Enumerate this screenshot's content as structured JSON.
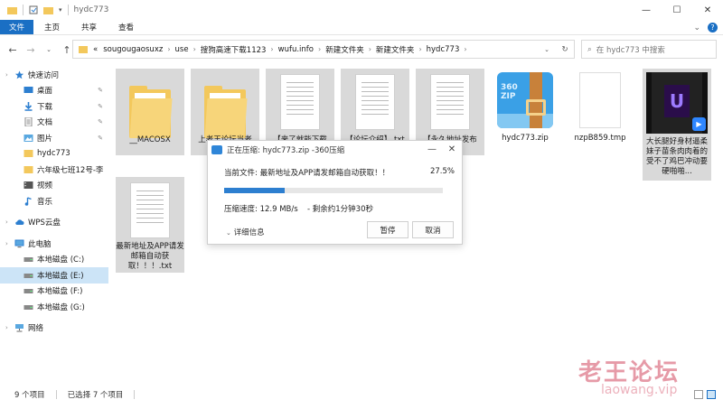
{
  "window": {
    "title": "hydc773",
    "controls": [
      "—",
      "☐",
      "✕"
    ]
  },
  "ribbon": {
    "tabs": [
      "文件",
      "主页",
      "共享",
      "查看"
    ],
    "active_tab": "文件"
  },
  "address": {
    "overflow": "«",
    "crumbs": [
      "sougougaosuxz",
      "use",
      "搜狗高速下载1123",
      "wufu.info",
      "新建文件夹",
      "新建文件夹",
      "hydc773"
    ]
  },
  "search": {
    "placeholder": "在 hydc773 中搜索"
  },
  "nav": {
    "items": [
      {
        "label": "快速访问",
        "level": 0,
        "icon": "star-icon"
      },
      {
        "label": "桌面",
        "level": 1,
        "icon": "desktop-icon",
        "pinned": true
      },
      {
        "label": "下载",
        "level": 1,
        "icon": "download-icon",
        "pinned": true
      },
      {
        "label": "文档",
        "level": 1,
        "icon": "document-icon",
        "pinned": true
      },
      {
        "label": "图片",
        "level": 1,
        "icon": "picture-icon",
        "pinned": true
      },
      {
        "label": "hydc773",
        "level": 1,
        "icon": "folder-icon"
      },
      {
        "label": "六年级七班12号-李",
        "level": 1,
        "icon": "folder-icon"
      },
      {
        "label": "视频",
        "level": 1,
        "icon": "video-icon"
      },
      {
        "label": "音乐",
        "level": 1,
        "icon": "music-icon"
      },
      {
        "label": "WPS云盘",
        "level": 0,
        "icon": "cloud-icon"
      },
      {
        "label": "此电脑",
        "level": 0,
        "icon": "computer-icon"
      },
      {
        "label": "本地磁盘 (C:)",
        "level": 1,
        "icon": "drive-icon"
      },
      {
        "label": "本地磁盘 (E:)",
        "level": 1,
        "icon": "drive-icon",
        "selected": true
      },
      {
        "label": "本地磁盘 (F:)",
        "level": 1,
        "icon": "drive-icon"
      },
      {
        "label": "本地磁盘 (G:)",
        "level": 1,
        "icon": "drive-icon"
      },
      {
        "label": "网络",
        "level": 0,
        "icon": "network-icon"
      }
    ]
  },
  "files": [
    {
      "name": "__MACOSX",
      "type": "folder"
    },
    {
      "name": "上老王论坛当老",
      "type": "folder"
    },
    {
      "name": "【来了就能下载",
      "type": "text"
    },
    {
      "name": "【论坛介绍】.txt",
      "type": "text"
    },
    {
      "name": "【永久地址发布",
      "type": "text"
    },
    {
      "name": "hydc773.zip",
      "type": "zip"
    },
    {
      "name": "nzpB859.tmp",
      "type": "blank"
    },
    {
      "name": "大长腿好身材逼柔妹子苗条肉肉着的受不了鸡巴冲动要硬啪啪...",
      "type": "video"
    },
    {
      "name": "最新地址及APP请发邮箱自动获取！！！.txt",
      "type": "text"
    }
  ],
  "zip_icon_text": "360 ZIP",
  "dialog": {
    "title": "正在压缩: hydc773.zip -360压缩",
    "current_file": "当前文件: 最新地址及APP请发邮箱自动获取！！",
    "percent_text": "27.5%",
    "percent": 27.5,
    "speed": "压缩速度: 12.9 MB/s",
    "remaining": "- 剩余约1分钟30秒",
    "details": "详细信息",
    "pause": "暂停",
    "cancel": "取消"
  },
  "status": {
    "count": "9 个项目",
    "selected": "已选择 7 个项目"
  },
  "watermark": {
    "cn": "老王论坛",
    "en": "laowang.vip"
  },
  "colors": {
    "accent": "#1a6fc4",
    "folder": "#f3c85c",
    "progress": "#2d7fd0"
  }
}
